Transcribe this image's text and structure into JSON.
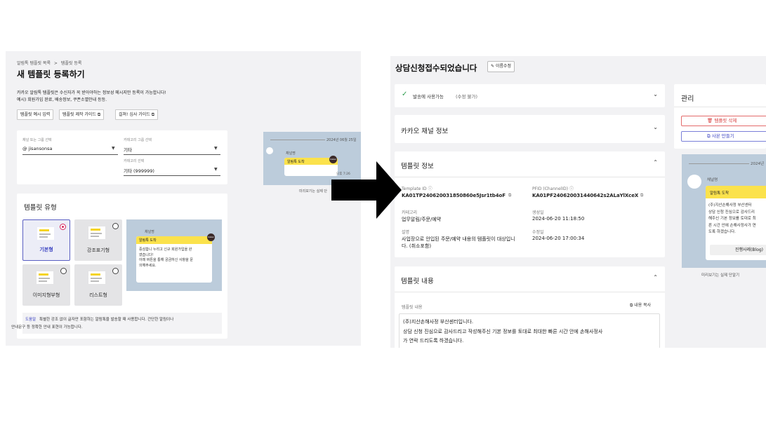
{
  "left": {
    "breadcrumb": [
      "알림톡 템플릿 목록",
      ">",
      "템플릿 등록"
    ],
    "title": "새 템플릿 등록하기",
    "description_lines": [
      "카카오 알림톡 템플릿은 수신자가 꼭 받아야하는 정보성 메시지만 등록이 가능합니다!",
      "예시) 회원가입 완료, 배송정보, 쿠폰소멸안내 등등."
    ],
    "buttons": [
      "템플릿 예시 입력",
      "템플릿 제작 가이드 ⧉",
      "걸쳐! 심사 가이드 ⧉"
    ],
    "form": {
      "channel_label": "채널 또는 그룹 선택",
      "channel_value": "@ jisansonsa",
      "category_group_label": "카테고리 그룹 선택",
      "category_group_value": "기타",
      "category_label": "카테고리 선택",
      "category_value": "기타 (999999)"
    },
    "template_type": {
      "title": "템플릿 유형",
      "options": [
        {
          "label": "기본형",
          "selected": true
        },
        {
          "label": "강조표기형",
          "selected": false
        },
        {
          "label": "이미지형부형",
          "selected": false
        },
        {
          "label": "리스트형",
          "selected": false
        }
      ],
      "preview": {
        "channel": "채널명",
        "header": "알림톡 도착",
        "body_lines": [
          "중심합니 누리고 신규 회원가입을 완",
          "였습니다!",
          "아래 버튼을 통해 궁금하신 사항을 문",
          "의해주세요."
        ],
        "kakao": "kakao"
      },
      "notice_tag": "도움말",
      "notice_lines": [
        "특별한 강조 없이 글자만 포함하는 알림톡을 발송할 때 사용합니다. 간단한 알림이나",
        "안내문구 등 정확한 안내 표현이 가능합니다."
      ]
    },
    "side_preview": {
      "date": "2024년 06월 25일",
      "channel": "채널명",
      "header": "알림톡 도착",
      "time": "오후 7:26",
      "caption": "미리보기는 실제 단",
      "kakao": "kakao"
    }
  },
  "right": {
    "title": "상담신청접수되었습니다",
    "edit_button": "이름수정",
    "status": {
      "label": "발송에 사용가능",
      "sub": "(수정 불가)"
    },
    "channel_section": "카카오 채널 정보",
    "template_info": {
      "title": "템플릿 정보",
      "template_id_label": "Template ID ⓘ",
      "template_id": "KA01TP240620031850860e5Jsr1tb4oF",
      "pfid_label": "PFID (ChannelID) ⓘ",
      "pfid": "KA01PF240620031440642s2ALaYlXceX",
      "category_label": "카테고리",
      "category_value": "업무알림/주문/예약",
      "created_label": "생성일",
      "created_value": "2024-06-20 11:18:50",
      "desc_label": "설명",
      "desc_lines": [
        "사업장으로 안입된 주문/예약 내용의 템플릿이 대상입니",
        "다. (취소포함)"
      ],
      "modified_label": "수정일",
      "modified_value": "2024-06-20 17:00:34"
    },
    "template_content": {
      "title": "템플릿 내용",
      "content_label": "템플릿 내용",
      "copy_label": "내용 복사",
      "lines": [
        "(주)지산손해사정 부산센터입니다.",
        "상담 신청 진심으로 감사드리고 작성해주신 기본 정보를 토대로 최대한 빠른 시간 안에 손해사정사",
        "가 연락 드리도록 하겠습니다."
      ]
    },
    "manage": {
      "title": "관리",
      "delete_button": "템플릿 삭제",
      "copy_button": "사본 만들기"
    },
    "preview": {
      "date": "2024년",
      "channel": "채널명",
      "header": "알림톡 도착",
      "body_lines": [
        "(주)지산손해사정 부산센터",
        "상담 신청 진심으로 감사드리",
        "해주신 기본 정보를 토대로 최",
        "른 시간 안에 손해사정사가 연",
        "도록 하겠습니다."
      ],
      "button": "진행사례(Blog)",
      "caption": "미리보기는 실제 단말기"
    }
  },
  "colors": {
    "accent": "#3c44c2",
    "danger": "#d63b3b",
    "kakao_yellow": "#fbe24c",
    "preview_bg": "#bcccdb"
  }
}
